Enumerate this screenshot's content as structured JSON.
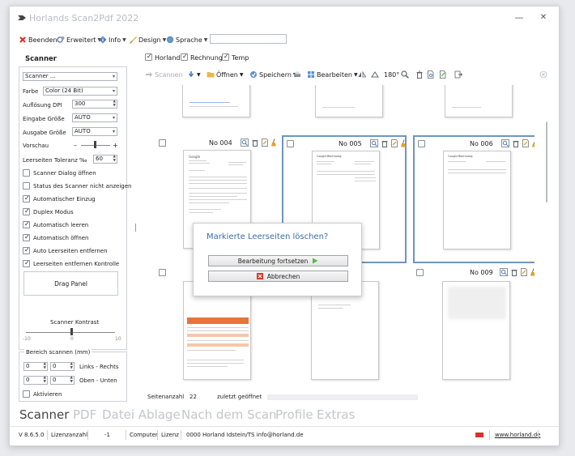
{
  "window": {
    "title": "Horlands Scan2Pdf 2022",
    "controls": {
      "minimize": "—",
      "maximize": "☐",
      "close": "✕"
    }
  },
  "menu": {
    "items": [
      {
        "label": "Beenden",
        "icon": "exit-icon",
        "dropdown": false
      },
      {
        "label": "Erweitert",
        "icon": "gears-icon",
        "dropdown": true
      },
      {
        "label": "Info",
        "icon": "info-icon",
        "dropdown": true
      },
      {
        "label": "Design",
        "icon": "brush-icon",
        "dropdown": true
      },
      {
        "label": "Sprache",
        "icon": "globe-icon",
        "dropdown": true
      }
    ],
    "search_value": ""
  },
  "scanner_panel": {
    "title": "Scanner",
    "scanner_select": "Scanner ...",
    "farbe_label": "Farbe",
    "farbe_value": "Color (24 Bit)",
    "dpi_label": "Auflösung DPI",
    "dpi_value": "300",
    "eingabe_label": "Eingabe Größe",
    "eingabe_value": "AUTO",
    "ausgabe_label": "Ausgabe Größe",
    "ausgabe_value": "AUTO",
    "vorschau_label": "Vorschau",
    "vorschau_minus": "–",
    "vorschau_plus": "+",
    "toleranz_label": "Leerseiten Toleranz ‰",
    "toleranz_value": "60",
    "options": [
      {
        "label": "Scanner Dialog öffnen",
        "checked": false
      },
      {
        "label": "Status des Scanner nicht anzeigen",
        "checked": false
      },
      {
        "label": "Automatischer Einzug",
        "checked": true
      },
      {
        "label": "Duplex Modus",
        "checked": true
      },
      {
        "label": "Automatisch leeren",
        "checked": true
      },
      {
        "label": "Automatisch öffnen",
        "checked": true
      },
      {
        "label": "Auto Leerseiten entfernen",
        "checked": true
      },
      {
        "label": "Leerseiten entfernen Kontrolle",
        "checked": true
      }
    ],
    "drag_panel": "Drag Panel",
    "kontrast_label": "Scanner Kontrast",
    "kontrast_ticks": [
      "-10",
      "0",
      "10"
    ]
  },
  "area_panel": {
    "title": "Bereich scannen (mm)",
    "row1": {
      "a": "0",
      "b": "0",
      "label": "Links - Rechts"
    },
    "row2": {
      "a": "0",
      "b": "0",
      "label": "Oben - Unten"
    },
    "aktivieren": "Aktivieren"
  },
  "filters": [
    {
      "label": "Horland",
      "checked": true
    },
    {
      "label": "Rechnung",
      "checked": true
    },
    {
      "label": "Temp",
      "checked": true
    }
  ],
  "toolbar": {
    "scannen": "Scannen",
    "oeffnen": "Öffnen",
    "speichern": "Speichern",
    "bearbeiten": "Bearbeiten",
    "rotate": "180°"
  },
  "documents": [
    {
      "title": "No 004",
      "selected": false
    },
    {
      "title": "No 005",
      "selected": true
    },
    {
      "title": "No 006",
      "selected": true
    },
    {
      "title": "No 009",
      "selected": false
    }
  ],
  "page_text": {
    "logo": "Google",
    "heading": "Rechnung"
  },
  "status": {
    "seitenanzahl_label": "Seitenanzahl",
    "seitenanzahl_value": "22",
    "zuletzt_label": "zuletzt geöffnet"
  },
  "tabs": [
    "Scanner",
    "PDF",
    "Datei Ablage",
    "Nach dem Scan",
    "Profile",
    "Extras"
  ],
  "footer": {
    "version": "V 8.6.5.0",
    "lizenzanzahl_label": "Lizenzanzahl",
    "lizenzanzahl_value": "-1",
    "computer_label": "Computer",
    "lizenz_label": "Lizenz",
    "lizenz_value": "0000 Horland Idstein/TS info@horland.de",
    "link": "www.horland.de"
  },
  "dialog": {
    "title": "Markierte Leerseiten löschen?",
    "continue_label": "Bearbeitung fortsetzen",
    "cancel_label": "Abbrechen"
  },
  "colors": {
    "accent": "#3b6fa8",
    "selection_border": "#6f95bf",
    "inactive_tab": "#c3c6cb",
    "cancel_red": "#d9342b",
    "continue_green": "#58b947"
  }
}
